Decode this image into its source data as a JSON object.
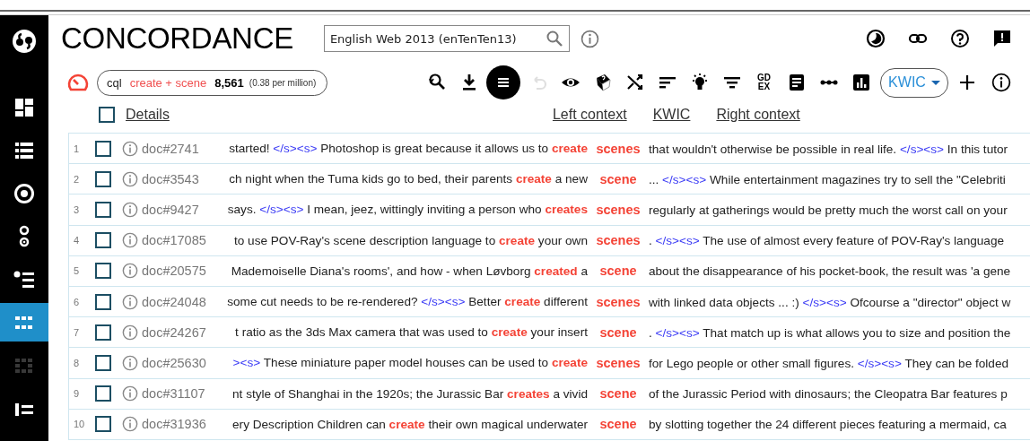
{
  "sidebar": {
    "items": [
      {
        "selected": false,
        "disabled": false
      },
      {
        "selected": false,
        "disabled": false
      },
      {
        "selected": false,
        "disabled": false
      },
      {
        "selected": false,
        "disabled": false
      },
      {
        "selected": false,
        "disabled": false
      },
      {
        "selected": true,
        "disabled": false
      },
      {
        "selected": false,
        "disabled": true
      },
      {
        "selected": false,
        "disabled": false
      }
    ]
  },
  "header": {
    "title": "CONCORDANCE",
    "corpus": {
      "value": "English Web 2013 (enTenTen13)"
    }
  },
  "query": {
    "type": "cql",
    "text": "create + scene",
    "count": "8,561",
    "relative": "(0.38 per million)"
  },
  "toolbar": {
    "tools": [
      {
        "selected": false,
        "disabled": false
      },
      {
        "selected": false,
        "disabled": false
      },
      {
        "selected": true,
        "disabled": false
      },
      {
        "selected": false,
        "disabled": true
      },
      {
        "selected": false,
        "disabled": false
      },
      {
        "selected": false,
        "disabled": false
      },
      {
        "selected": false,
        "disabled": false
      },
      {
        "selected": false,
        "disabled": false
      },
      {
        "selected": false,
        "disabled": false
      },
      {
        "selected": false,
        "disabled": false
      },
      {
        "selected": false,
        "disabled": false,
        "label": "GD EX"
      },
      {
        "selected": false,
        "disabled": false
      },
      {
        "selected": false,
        "disabled": false
      },
      {
        "selected": false,
        "disabled": false
      }
    ],
    "view": {
      "label": "KWIC"
    }
  },
  "columns": {
    "checked": false,
    "details": "Details",
    "left": "Left context",
    "kwic": "KWIC",
    "right": "Right context"
  },
  "rows": [
    {
      "num": "1",
      "checked": false,
      "doc": "doc#2741",
      "kwic": "scenes",
      "left": [
        {
          "kind": "text",
          "text": "started! "
        },
        {
          "kind": "tag",
          "text": "</s><s>"
        },
        {
          "kind": "text",
          "text": " Photoshop is great because it allows us to "
        },
        {
          "kind": "hit",
          "text": "create"
        }
      ],
      "right": [
        {
          "kind": "text",
          "text": "that wouldn't otherwise be possible in real life. "
        },
        {
          "kind": "tag",
          "text": "</s><s>"
        },
        {
          "kind": "text",
          "text": " In this tutor"
        }
      ]
    },
    {
      "num": "2",
      "checked": false,
      "doc": "doc#3543",
      "kwic": "scene",
      "left": [
        {
          "kind": "text",
          "text": "ch night when the Tuma kids go to bed, their parents "
        },
        {
          "kind": "hit",
          "text": "create"
        },
        {
          "kind": "text",
          "text": " a new"
        }
      ],
      "right": [
        {
          "kind": "text",
          "text": "... "
        },
        {
          "kind": "tag",
          "text": "</s><s>"
        },
        {
          "kind": "text",
          "text": " While entertainment magazines try to sell the \"Celebriti"
        }
      ]
    },
    {
      "num": "3",
      "checked": false,
      "doc": "doc#9427",
      "kwic": "scenes",
      "left": [
        {
          "kind": "text",
          "text": "says. "
        },
        {
          "kind": "tag",
          "text": "</s><s>"
        },
        {
          "kind": "text",
          "text": " I mean, jeez, wittingly inviting a person who "
        },
        {
          "kind": "hit",
          "text": "creates"
        }
      ],
      "right": [
        {
          "kind": "text",
          "text": "regularly at gatherings would be pretty much the worst call on your"
        }
      ]
    },
    {
      "num": "4",
      "checked": false,
      "doc": "doc#17085",
      "kwic": "scenes",
      "left": [
        {
          "kind": "text",
          "text": "to use POV-Ray's scene description language to "
        },
        {
          "kind": "hit",
          "text": "create"
        },
        {
          "kind": "text",
          "text": " your own"
        }
      ],
      "right": [
        {
          "kind": "text",
          "text": ". "
        },
        {
          "kind": "tag",
          "text": "</s><s>"
        },
        {
          "kind": "text",
          "text": " The use of almost every feature of POV-Ray's language"
        }
      ]
    },
    {
      "num": "5",
      "checked": false,
      "doc": "doc#20575",
      "kwic": "scene",
      "left": [
        {
          "kind": "text",
          "text": "Mademoiselle Diana's rooms', and how - when Løvborg "
        },
        {
          "kind": "hit",
          "text": "created"
        },
        {
          "kind": "text",
          "text": " a"
        }
      ],
      "right": [
        {
          "kind": "text",
          "text": "about the disappearance of his pocket-book, the result was 'a gene"
        }
      ]
    },
    {
      "num": "6",
      "checked": false,
      "doc": "doc#24048",
      "kwic": "scenes",
      "left": [
        {
          "kind": "text",
          "text": "some cut needs to be re-rendered? "
        },
        {
          "kind": "tag",
          "text": "</s><s>"
        },
        {
          "kind": "text",
          "text": " Better "
        },
        {
          "kind": "hit",
          "text": "create"
        },
        {
          "kind": "text",
          "text": " different"
        }
      ],
      "right": [
        {
          "kind": "text",
          "text": "with linked data objects ... :) "
        },
        {
          "kind": "tag",
          "text": "</s><s>"
        },
        {
          "kind": "text",
          "text": " Ofcourse a \"director\" object w"
        }
      ]
    },
    {
      "num": "7",
      "checked": false,
      "doc": "doc#24267",
      "kwic": "scene",
      "left": [
        {
          "kind": "text",
          "text": "t ratio as the 3ds Max camera that was used to "
        },
        {
          "kind": "hit",
          "text": "create"
        },
        {
          "kind": "text",
          "text": " your insert"
        }
      ],
      "right": [
        {
          "kind": "text",
          "text": ". "
        },
        {
          "kind": "tag",
          "text": "</s><s>"
        },
        {
          "kind": "text",
          "text": " That match up is what allows you to size and position the"
        }
      ]
    },
    {
      "num": "8",
      "checked": false,
      "doc": "doc#25630",
      "kwic": "scenes",
      "left": [
        {
          "kind": "tag",
          "text": "><s>"
        },
        {
          "kind": "text",
          "text": " These miniature paper model houses can be used to "
        },
        {
          "kind": "hit",
          "text": "create"
        }
      ],
      "right": [
        {
          "kind": "text",
          "text": "for Lego people or other small figures. "
        },
        {
          "kind": "tag",
          "text": "</s><s>"
        },
        {
          "kind": "text",
          "text": " They can be folded"
        }
      ]
    },
    {
      "num": "9",
      "checked": false,
      "doc": "doc#31107",
      "kwic": "scene",
      "left": [
        {
          "kind": "text",
          "text": "nt style of Shanghai in the 1920s; the Jurassic Bar "
        },
        {
          "kind": "hit",
          "text": "creates"
        },
        {
          "kind": "text",
          "text": " a vivid"
        }
      ],
      "right": [
        {
          "kind": "text",
          "text": "of the Jurassic Period with dinosaurs; the Cleopatra Bar features p"
        }
      ]
    },
    {
      "num": "10",
      "checked": false,
      "doc": "doc#31936",
      "kwic": "scene",
      "left": [
        {
          "kind": "text",
          "text": "ery Description Children can "
        },
        {
          "kind": "hit",
          "text": "create"
        },
        {
          "kind": "text",
          "text": " their own magical underwater"
        }
      ],
      "right": [
        {
          "kind": "text",
          "text": "by slotting together the 24 different pieces featuring a mermaid, ca"
        }
      ]
    }
  ]
}
